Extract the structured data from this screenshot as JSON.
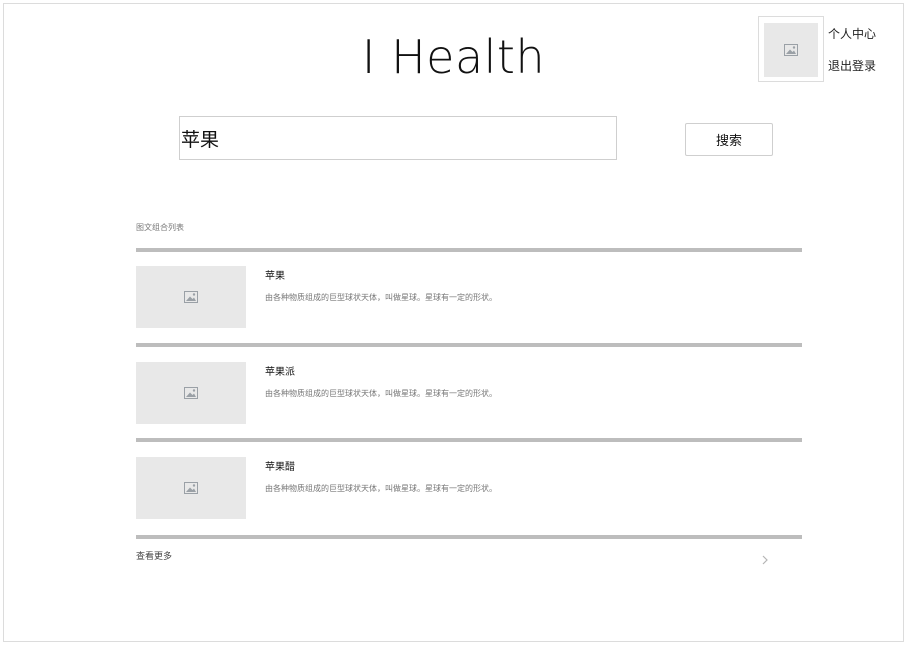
{
  "app": {
    "title": "I  Health"
  },
  "user": {
    "profile_label": "个人中心",
    "logout_label": "退出登录",
    "avatar_icon": "image-placeholder-icon"
  },
  "search": {
    "value": "苹果",
    "button_label": "搜索"
  },
  "results": {
    "section_title": "图文组合列表",
    "items": [
      {
        "name": "苹果",
        "description": "由各种物质组成的巨型球状天体，叫做星球。星球有一定的形状。",
        "thumb_icon": "image-placeholder-icon"
      },
      {
        "name": "苹果派",
        "description": "由各种物质组成的巨型球状天体，叫做星球。星球有一定的形状。",
        "thumb_icon": "image-placeholder-icon"
      },
      {
        "name": "苹果醋",
        "description": "由各种物质组成的巨型球状天体，叫做星球。星球有一定的形状。",
        "thumb_icon": "image-placeholder-icon"
      }
    ],
    "more_label": "查看更多",
    "more_icon": "chevron-right-icon"
  },
  "colors": {
    "divider": "#bdbdbd",
    "placeholder": "#e8e8e8",
    "border": "#cfcfcf"
  }
}
